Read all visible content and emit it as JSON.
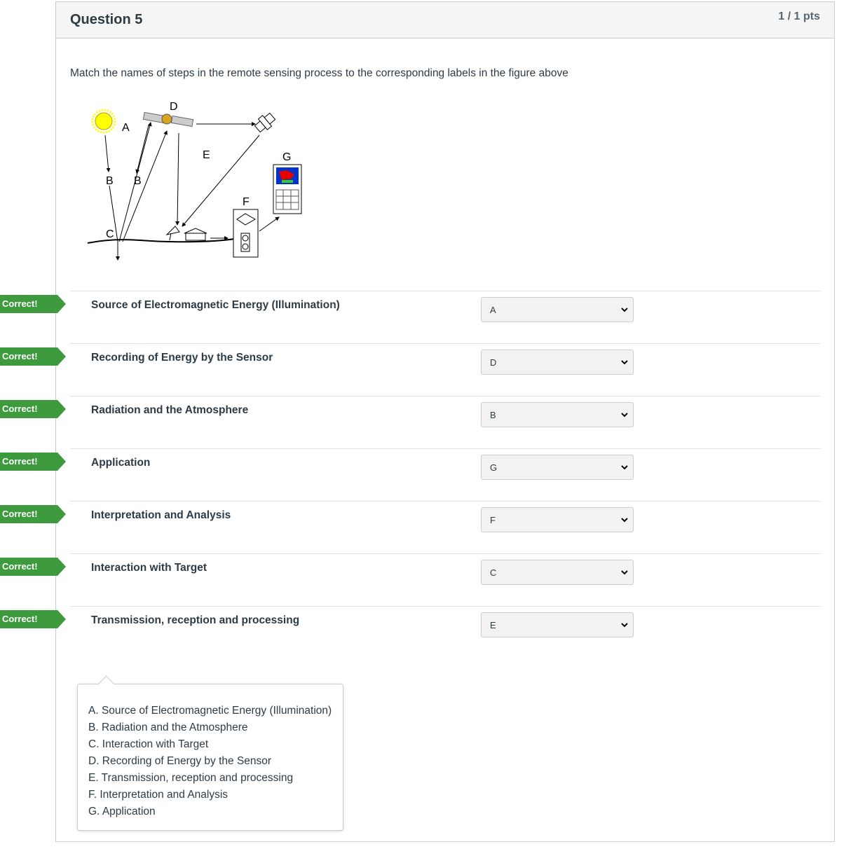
{
  "question": {
    "title": "Question 5",
    "points": "1 / 1 pts",
    "prompt": "Match the names of steps in the remote sensing process to the corresponding labels in the figure above"
  },
  "figure": {
    "labels": [
      "A",
      "B",
      "B",
      "C",
      "D",
      "E",
      "F",
      "G"
    ]
  },
  "correct_label": "Correct!",
  "answers": [
    {
      "label": "Source of Electromagnetic Energy (Illumination)",
      "selected": "A"
    },
    {
      "label": "Recording of Energy by the Sensor",
      "selected": "D"
    },
    {
      "label": "Radiation and the Atmosphere",
      "selected": "B"
    },
    {
      "label": "Application",
      "selected": "G"
    },
    {
      "label": "Interpretation and Analysis",
      "selected": "F"
    },
    {
      "label": "Interaction with Target",
      "selected": "C"
    },
    {
      "label": "Transmission, reception and processing",
      "selected": "E"
    }
  ],
  "legend": [
    "A. Source of Electromagnetic Energy (Illumination)",
    "B. Radiation and the Atmosphere",
    "C. Interaction with Target",
    "D. Recording of Energy by the Sensor",
    "E. Transmission, reception and processing",
    "F. Interpretation and Analysis",
    "G. Application"
  ],
  "colors": {
    "correct_green": "#3d9a3d",
    "header_bg": "#f5f5f5",
    "border": "#c7cdd1"
  }
}
